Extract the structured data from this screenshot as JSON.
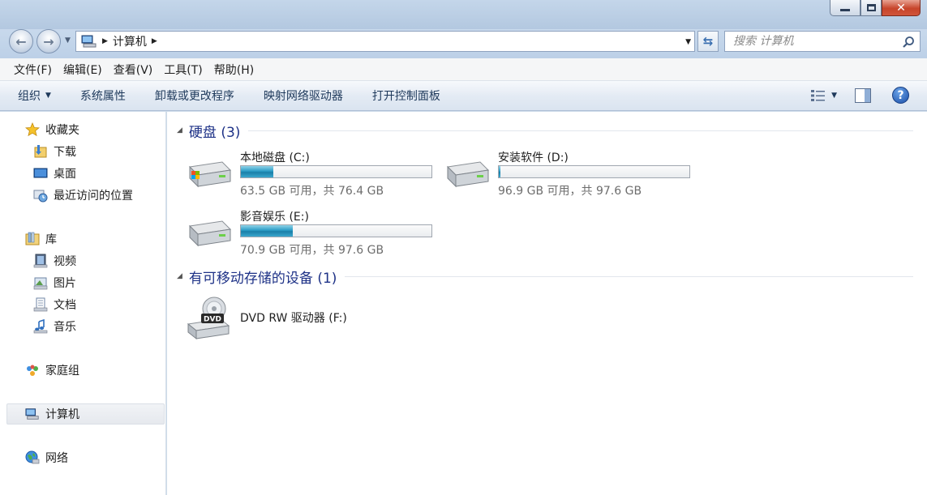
{
  "window": {
    "close_glyph": "✕"
  },
  "address": {
    "path": [
      "计算机"
    ],
    "search_placeholder": "搜索 计算机"
  },
  "menu": [
    "文件(F)",
    "编辑(E)",
    "查看(V)",
    "工具(T)",
    "帮助(H)"
  ],
  "commands": {
    "organize": "组织",
    "items": [
      "系统属性",
      "卸载或更改程序",
      "映射网络驱动器",
      "打开控制面板"
    ]
  },
  "navigation": {
    "favorites": {
      "label": "收藏夹",
      "items": [
        "下载",
        "桌面",
        "最近访问的位置"
      ]
    },
    "libraries": {
      "label": "库",
      "items": [
        "视频",
        "图片",
        "文档",
        "音乐"
      ]
    },
    "homegroup": "家庭组",
    "computer": "计算机",
    "network": "网络"
  },
  "groups": {
    "hard_disks": {
      "title": "硬盘 (3)",
      "drives": [
        {
          "name": "本地磁盘 (C:)",
          "free_text": "63.5 GB 可用，共 76.4 GB",
          "used_fraction": 0.169,
          "system": true
        },
        {
          "name": "安装软件 (D:)",
          "free_text": "96.9 GB 可用，共 97.6 GB",
          "used_fraction": 0.007,
          "system": false
        },
        {
          "name": "影音娱乐 (E:)",
          "free_text": "70.9 GB 可用，共 97.6 GB",
          "used_fraction": 0.274,
          "system": false
        }
      ]
    },
    "removable": {
      "title": "有可移动存储的设备 (1)",
      "devices": [
        {
          "name": "DVD RW 驱动器 (F:)",
          "badge": "DVD"
        }
      ]
    }
  },
  "colors": {
    "accent_title": "#1e3287",
    "usage_bar": "#2b9cc6"
  }
}
